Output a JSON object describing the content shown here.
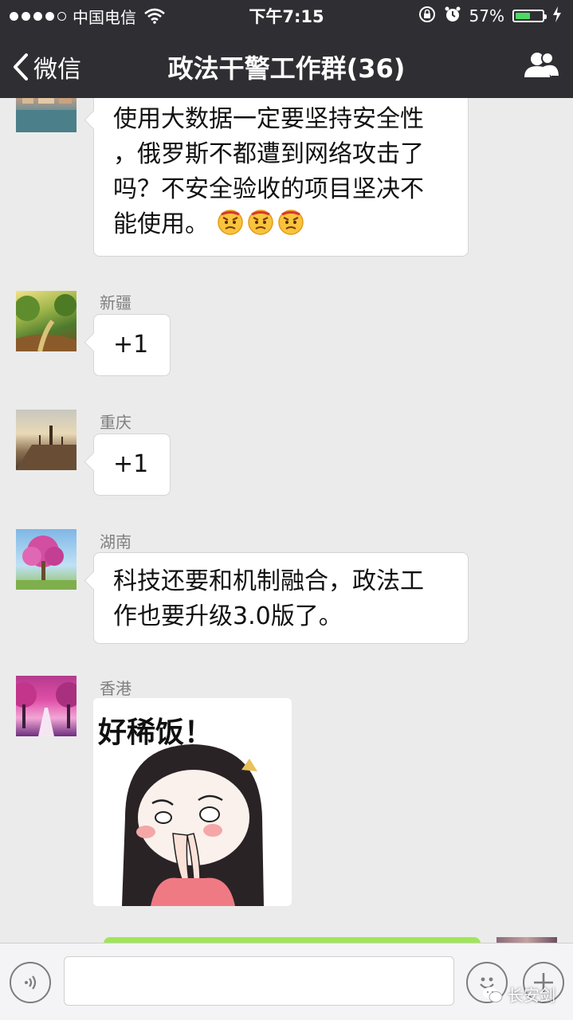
{
  "status_bar": {
    "carrier": "中国电信",
    "time": "下午7:15",
    "battery_percent": "57%",
    "battery_level": 0.57,
    "signal_strength": 4,
    "signal_max": 5
  },
  "nav": {
    "back_label": "微信",
    "title": "政法干警工作群(36)",
    "icons": {
      "back": "chevron-left-icon",
      "members": "people-icon"
    }
  },
  "messages": [
    {
      "sender": "",
      "type": "text",
      "text": "使用大数据一定要坚持安全性，俄罗斯不都遭到网络攻击了吗？不安全验收的项目坚决不能使用。",
      "lines": [
        "使用大数据一定要坚持安全性",
        "，俄罗斯不都遭到网络攻击了",
        "吗？不安全验收的项目坚决不",
        "能使用。"
      ],
      "emoji_count": 3,
      "emoji": "angry-face-emoji"
    },
    {
      "sender": "新疆",
      "type": "text",
      "text": "+1"
    },
    {
      "sender": "重庆",
      "type": "text",
      "text": "+1"
    },
    {
      "sender": "湖南",
      "type": "text",
      "lines": [
        "科技还要和机制融合，政法工",
        "作也要升级3.0版了。"
      ]
    },
    {
      "sender": "香港",
      "type": "sticker",
      "sticker_text": "好稀饭！"
    }
  ],
  "input_bar": {
    "value": "",
    "icons": {
      "voice": "voice-icon",
      "emoji": "smiley-icon",
      "plus": "plus-icon"
    }
  },
  "watermark": {
    "text": "长安剑"
  },
  "colors": {
    "header_bg": "#2e2e33",
    "chat_bg": "#ebebeb",
    "self_bubble": "#9fe658",
    "battery_fill": "#4cd964"
  }
}
